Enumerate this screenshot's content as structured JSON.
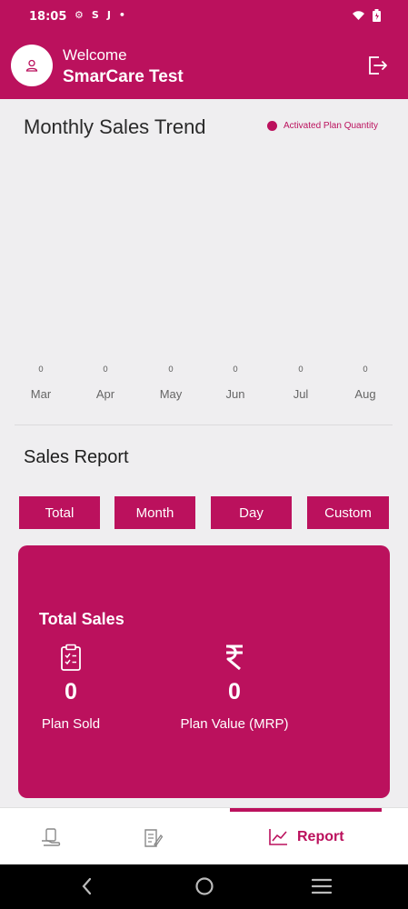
{
  "status_bar": {
    "time": "18:05",
    "icons": [
      "gear-icon",
      "s-icon",
      "j-icon",
      "dot-icon"
    ],
    "right_icons": [
      "wifi-icon",
      "battery-icon"
    ]
  },
  "header": {
    "welcome": "Welcome",
    "username": "SmarCare Test"
  },
  "chart": {
    "title": "Monthly Sales Trend",
    "legend": "Activated Plan Quantity"
  },
  "chart_data": {
    "type": "bar",
    "title": "Monthly Sales Trend",
    "categories": [
      "Mar",
      "Apr",
      "May",
      "Jun",
      "Jul",
      "Aug"
    ],
    "series": [
      {
        "name": "Activated Plan Quantity",
        "values": [
          0,
          0,
          0,
          0,
          0,
          0
        ]
      }
    ],
    "data_labels": [
      "0",
      "0",
      "0",
      "0",
      "0",
      "0"
    ],
    "grid": false,
    "legend": "top-right",
    "color": "#bb115d"
  },
  "sales_report": {
    "title": "Sales Report",
    "tabs": [
      {
        "label": "Total"
      },
      {
        "label": "Month"
      },
      {
        "label": "Day"
      },
      {
        "label": "Custom"
      }
    ],
    "card": {
      "title": "Total Sales",
      "plan_sold_value": "0",
      "plan_sold_label": "Plan Sold",
      "plan_value_value": "0",
      "plan_value_label": "Plan Value (MRP)"
    }
  },
  "bottom_nav": {
    "active_label": "Report"
  },
  "colors": {
    "primary": "#bb115d",
    "background": "#efeef0"
  }
}
